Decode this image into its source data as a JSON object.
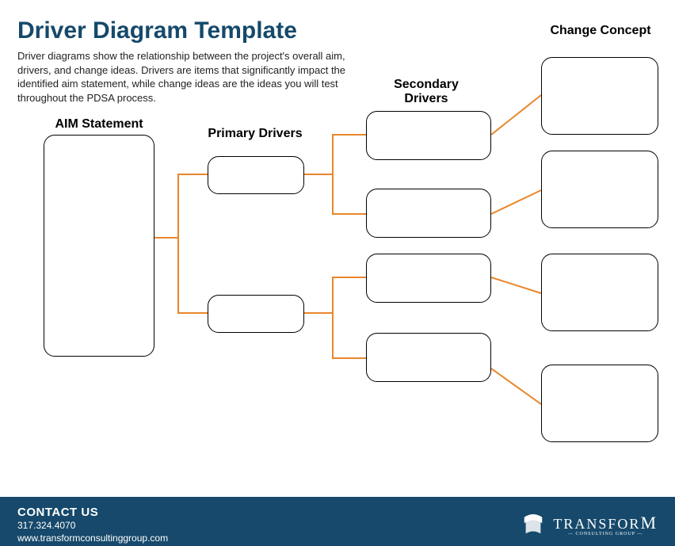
{
  "title": "Driver Diagram Template",
  "subtitle": "Driver diagrams show the relationship between the project's overall aim, drivers, and change ideas. Drivers are items that significantly impact the identified aim statement, while change ideas are the ideas you will test throughout the PDSA process.",
  "columns": {
    "aim": "AIM Statement",
    "primary": "Primary Drivers",
    "secondary": "Secondary Drivers",
    "change": "Change Concept"
  },
  "footer": {
    "contact_title": "CONTACT US",
    "phone": "317.324.4070",
    "website": "www.transformconsultinggroup.com",
    "brand_main": "TRANSFOR",
    "brand_m": "M",
    "brand_sub": "— CONSULTING GROUP —"
  },
  "colors": {
    "brand_dark": "#16496b",
    "connector": "#e8872b"
  }
}
